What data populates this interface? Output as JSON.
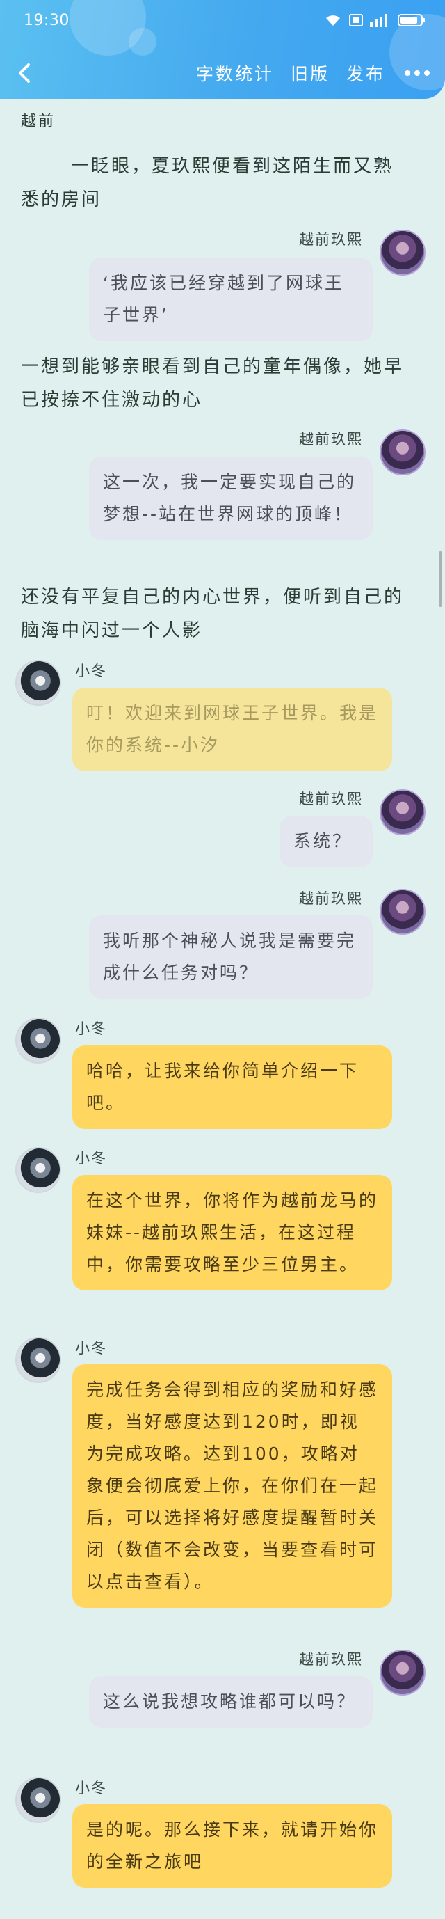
{
  "status": {
    "time": "19:30"
  },
  "nav": {
    "word_count": "字数统计",
    "old_version": "旧版",
    "publish": "发布"
  },
  "narrations": {
    "n0": "越前",
    "n1": "一眨眼，夏玖熙便看到这陌生而又熟悉的房间",
    "n2": "一想到能够亲眼看到自己的童年偶像，她早已按捺不住激动的心",
    "n3": "还没有平复自己的内心世界，便听到自己的脑海中闪过一个人影"
  },
  "names": {
    "me": "越前玖熙",
    "system": "小冬"
  },
  "messages": {
    "m1": "‘我应该已经穿越到了网球王子世界’",
    "m2": "这一次，我一定要实现自己的梦想--站在世界网球的顶峰！",
    "m3": "叮！欢迎来到网球王子世界。我是你的系统--小汐",
    "m4": "系统？",
    "m5": "我听那个神秘人说我是需要完成什么任务对吗？",
    "m6": "哈哈，让我来给你简单介绍一下吧。",
    "m7": "在这个世界，你将作为越前龙马的妹妹--越前玖熙生活，在这过程中，你需要攻略至少三位男主。",
    "m8": "完成任务会得到相应的奖励和好感度，当好感度达到120时，即视为完成攻略。达到100，攻略对象便会彻底爱上你，在你们在一起后，可以选择将好感度提醒暂时关闭（数值不会改变，当要查看时可以点击查看）。",
    "m9": "这么说我想攻略谁都可以吗？",
    "m10": "是的呢。那么接下来，就请开始你的全新之旅吧"
  }
}
